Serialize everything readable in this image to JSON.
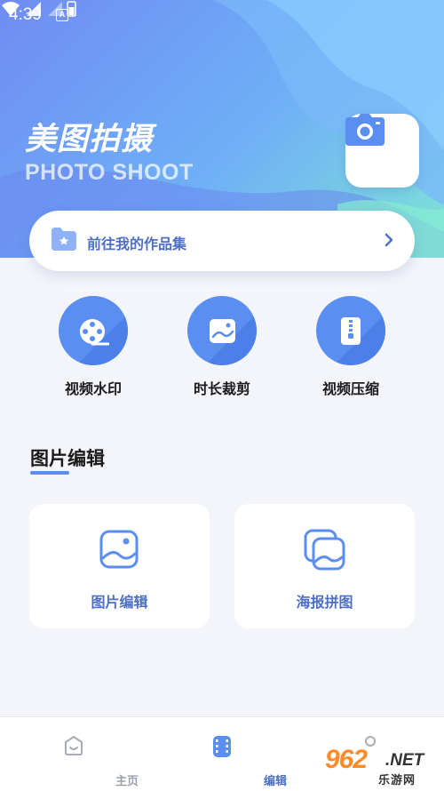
{
  "status_bar": {
    "time": "4:39",
    "notification_letter": "A"
  },
  "hero": {
    "title": "美图拍摄",
    "subtitle": "PHOTO SHOOT",
    "camera_icon": "camera-icon"
  },
  "works_bar": {
    "label": "前往我的作品集",
    "icon": "folder-star-icon",
    "arrow": "chevron-right-icon"
  },
  "tools": [
    {
      "label": "视频水印",
      "icon": "film-reel-icon"
    },
    {
      "label": "时长裁剪",
      "icon": "image-crop-icon"
    },
    {
      "label": "视频压缩",
      "icon": "zip-file-icon"
    }
  ],
  "section": {
    "title": "图片编辑"
  },
  "cards": [
    {
      "label": "图片编辑",
      "icon": "picture-icon"
    },
    {
      "label": "海报拼图",
      "icon": "picture-stack-icon"
    }
  ],
  "bottom_nav": [
    {
      "label": "主页",
      "icon": "home-icon",
      "active": false
    },
    {
      "label": "编辑",
      "icon": "film-edit-icon",
      "active": true
    },
    {
      "label": "",
      "icon": "profile-icon",
      "active": false
    }
  ],
  "watermark": {
    "number": "962",
    "suffix": ".NET",
    "site": "乐游网"
  },
  "colors": {
    "accent": "#5b8ef1",
    "label_blue": "#4e6fc6",
    "nav_inactive": "#9aa0ab",
    "nav_active": "#4e6fc6"
  }
}
